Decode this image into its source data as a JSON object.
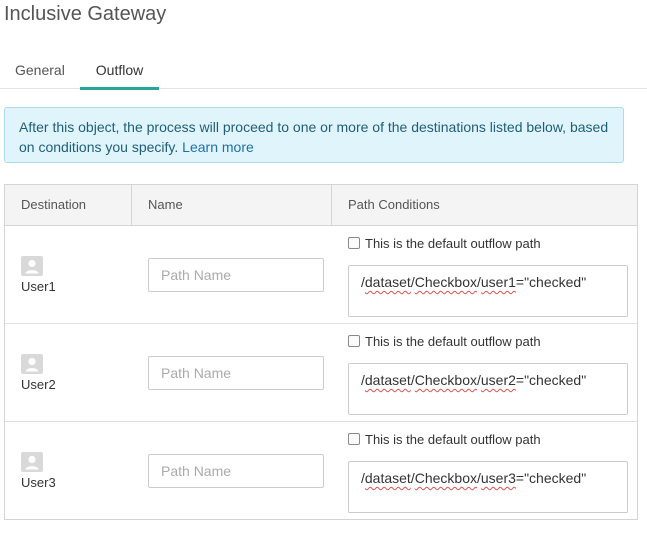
{
  "title": "Inclusive Gateway",
  "tabs": [
    {
      "label": "General",
      "active": false
    },
    {
      "label": "Outflow",
      "active": true
    }
  ],
  "info": {
    "text": "After this object, the process will proceed to one or more of the destinations listed below, based on conditions you specify.",
    "link": "Learn more"
  },
  "table": {
    "headers": [
      "Destination",
      "Name",
      "Path Conditions"
    ],
    "rows": [
      {
        "destination": "User1",
        "name_placeholder": "Path Name",
        "default_label": "This is the default outflow path",
        "condition": {
          "prefix": "/",
          "p1": "dataset",
          "s1": "/",
          "p2": "Checkbox",
          "s2": "/",
          "p3": "user1",
          "suffix": "=\"checked\""
        }
      },
      {
        "destination": "User2",
        "name_placeholder": "Path Name",
        "default_label": "This is the default outflow path",
        "condition": {
          "prefix": "/",
          "p1": "dataset",
          "s1": "/",
          "p2": "Checkbox",
          "s2": "/",
          "p3": "user2",
          "suffix": "=\"checked\""
        }
      },
      {
        "destination": "User3",
        "name_placeholder": "Path Name",
        "default_label": "This is the default outflow path",
        "condition": {
          "prefix": "/",
          "p1": "dataset",
          "s1": "/",
          "p2": "Checkbox",
          "s2": "/",
          "p3": "user3",
          "suffix": "=\"checked\""
        }
      }
    ]
  },
  "colors": {
    "accent": "#26a69a",
    "info_bg": "#e0f4fb",
    "link": "#1f6fa8"
  },
  "icons": {
    "avatar": "user-avatar-icon"
  }
}
